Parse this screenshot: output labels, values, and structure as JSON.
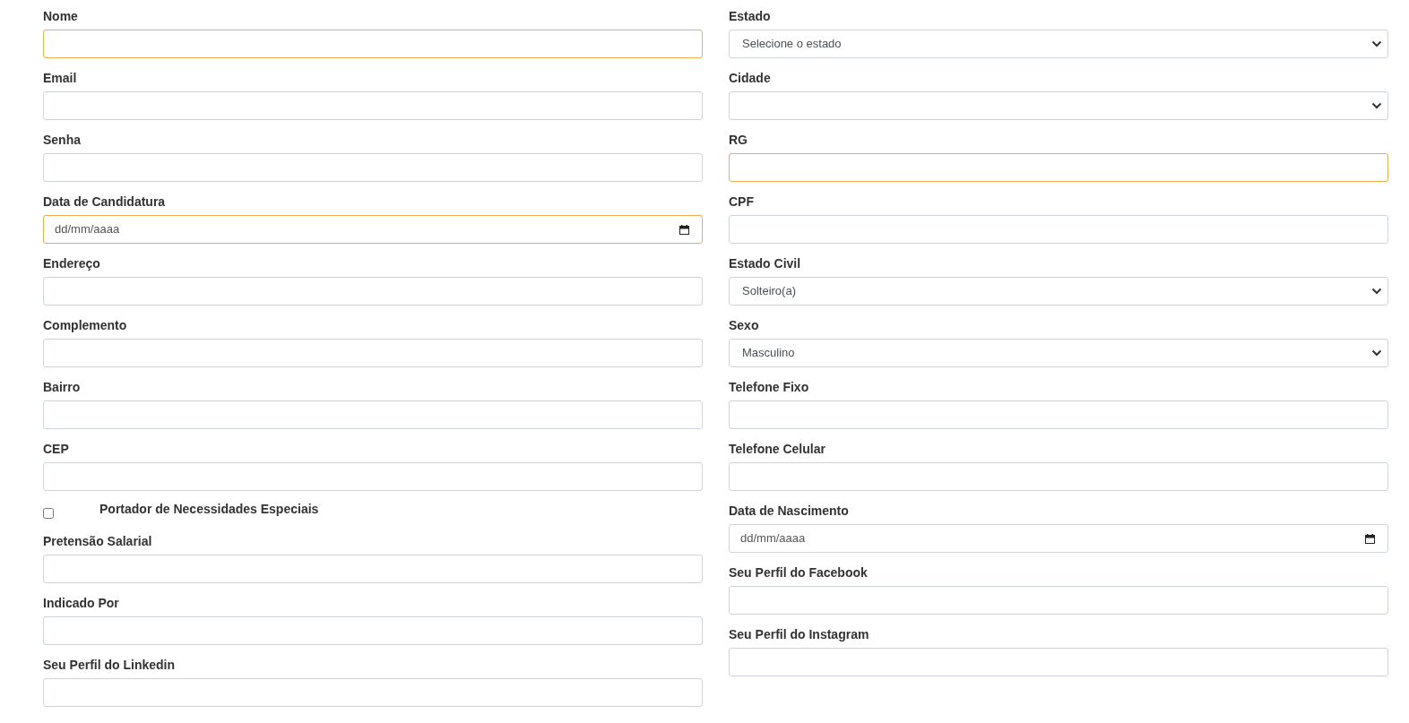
{
  "columns": [
    {
      "fields": [
        {
          "kind": "text",
          "label": "Nome",
          "highlighted": true
        },
        {
          "kind": "text",
          "label": "Email",
          "highlighted": false
        },
        {
          "kind": "text",
          "label": "Senha",
          "highlighted": false
        },
        {
          "kind": "date",
          "label": "Data de Candidatura",
          "placeholder": "dd/mm/aaaa",
          "highlighted": true
        },
        {
          "kind": "text",
          "label": "Endereço",
          "highlighted": false
        },
        {
          "kind": "text",
          "label": "Complemento",
          "highlighted": false
        },
        {
          "kind": "text",
          "label": "Bairro",
          "highlighted": false
        },
        {
          "kind": "text",
          "label": "CEP",
          "highlighted": false
        },
        {
          "kind": "checkbox",
          "label": "Portador de Necessidades Especiais",
          "checked": false
        },
        {
          "kind": "text",
          "label": "Pretensão Salarial",
          "highlighted": false
        },
        {
          "kind": "text",
          "label": "Indicado Por",
          "highlighted": false
        },
        {
          "kind": "text",
          "label": "Seu Perfil do Linkedin",
          "highlighted": false
        }
      ]
    },
    {
      "fields": [
        {
          "kind": "select",
          "label": "Estado",
          "value": "Selecione o estado",
          "highlighted": false
        },
        {
          "kind": "select",
          "label": "Cidade",
          "highlighted": false
        },
        {
          "kind": "text",
          "label": "RG",
          "highlighted": true
        },
        {
          "kind": "text",
          "label": "CPF",
          "highlighted": false
        },
        {
          "kind": "select",
          "label": "Estado Civil",
          "value": "Solteiro(a)",
          "highlighted": false
        },
        {
          "kind": "select",
          "label": "Sexo",
          "value": "Masculino",
          "highlighted": false
        },
        {
          "kind": "text",
          "label": "Telefone Fixo",
          "highlighted": false
        },
        {
          "kind": "text",
          "label": "Telefone Celular",
          "highlighted": false
        },
        {
          "kind": "date",
          "label": "Data de Nascimento",
          "placeholder": "dd/mm/aaaa",
          "highlighted": false
        },
        {
          "kind": "text",
          "label": "Seu Perfil do Facebook",
          "highlighted": false
        },
        {
          "kind": "text",
          "label": "Seu Perfil do Instagram",
          "highlighted": false
        }
      ]
    }
  ]
}
